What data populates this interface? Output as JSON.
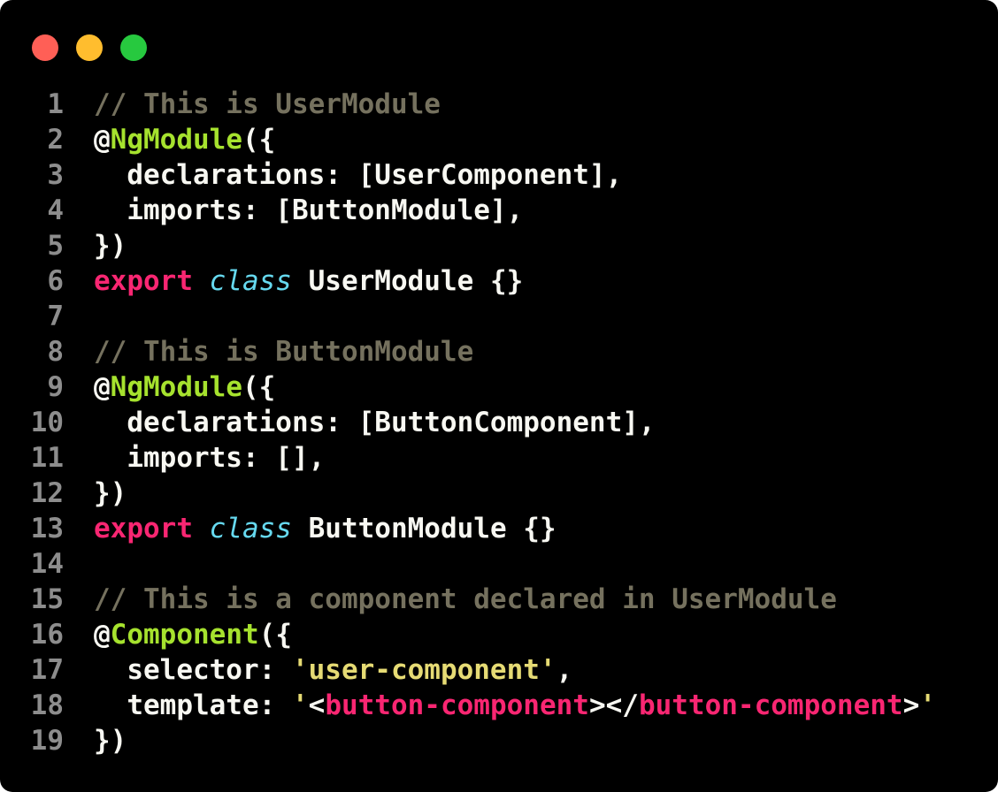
{
  "window_controls": {
    "close_color": "#ff5f56",
    "minimize_color": "#ffbd2e",
    "maximize_color": "#27c93f"
  },
  "colors": {
    "background": "#000000",
    "line_number": "#8d8d8d",
    "comment": "#75715e",
    "plain": "#f8f8f2",
    "decorator": "#a6e22e",
    "keyword": "#f92672",
    "class_keyword": "#66d9ef",
    "string": "#e6db74"
  },
  "code": {
    "lines": [
      {
        "n": "1",
        "tokens": [
          {
            "t": "// This is UserModule",
            "c": "comment"
          }
        ]
      },
      {
        "n": "2",
        "tokens": [
          {
            "t": "@",
            "c": "plain"
          },
          {
            "t": "NgModule",
            "c": "deco"
          },
          {
            "t": "({",
            "c": "plain"
          }
        ]
      },
      {
        "n": "3",
        "tokens": [
          {
            "t": "  declarations: [UserComponent],",
            "c": "plain"
          }
        ]
      },
      {
        "n": "4",
        "tokens": [
          {
            "t": "  imports: [ButtonModule],",
            "c": "plain"
          }
        ]
      },
      {
        "n": "5",
        "tokens": [
          {
            "t": "})",
            "c": "plain"
          }
        ]
      },
      {
        "n": "6",
        "tokens": [
          {
            "t": "export",
            "c": "keyword"
          },
          {
            "t": " ",
            "c": "plain"
          },
          {
            "t": "class",
            "c": "class"
          },
          {
            "t": " UserModule {}",
            "c": "plain"
          }
        ]
      },
      {
        "n": "7",
        "tokens": []
      },
      {
        "n": "8",
        "tokens": [
          {
            "t": "// This is ButtonModule",
            "c": "comment"
          }
        ]
      },
      {
        "n": "9",
        "tokens": [
          {
            "t": "@",
            "c": "plain"
          },
          {
            "t": "NgModule",
            "c": "deco"
          },
          {
            "t": "({",
            "c": "plain"
          }
        ]
      },
      {
        "n": "10",
        "tokens": [
          {
            "t": "  declarations: [ButtonComponent],",
            "c": "plain"
          }
        ]
      },
      {
        "n": "11",
        "tokens": [
          {
            "t": "  imports: [],",
            "c": "plain"
          }
        ]
      },
      {
        "n": "12",
        "tokens": [
          {
            "t": "})",
            "c": "plain"
          }
        ]
      },
      {
        "n": "13",
        "tokens": [
          {
            "t": "export",
            "c": "keyword"
          },
          {
            "t": " ",
            "c": "plain"
          },
          {
            "t": "class",
            "c": "class"
          },
          {
            "t": " ButtonModule {}",
            "c": "plain"
          }
        ]
      },
      {
        "n": "14",
        "tokens": []
      },
      {
        "n": "15",
        "tokens": [
          {
            "t": "// This is a component declared in UserModule",
            "c": "comment"
          }
        ]
      },
      {
        "n": "16",
        "tokens": [
          {
            "t": "@",
            "c": "plain"
          },
          {
            "t": "Component",
            "c": "deco"
          },
          {
            "t": "({",
            "c": "plain"
          }
        ]
      },
      {
        "n": "17",
        "tokens": [
          {
            "t": "  selector: ",
            "c": "plain"
          },
          {
            "t": "'user-component'",
            "c": "string"
          },
          {
            "t": ",",
            "c": "plain"
          }
        ]
      },
      {
        "n": "18",
        "tokens": [
          {
            "t": "  template: ",
            "c": "plain"
          },
          {
            "t": "'",
            "c": "string"
          },
          {
            "t": "<",
            "c": "plain"
          },
          {
            "t": "button-component",
            "c": "tag"
          },
          {
            "t": "></",
            "c": "plain"
          },
          {
            "t": "button-component",
            "c": "tag"
          },
          {
            "t": ">",
            "c": "plain"
          },
          {
            "t": "'",
            "c": "string"
          }
        ]
      },
      {
        "n": "19",
        "tokens": [
          {
            "t": "})",
            "c": "plain"
          }
        ]
      }
    ]
  }
}
